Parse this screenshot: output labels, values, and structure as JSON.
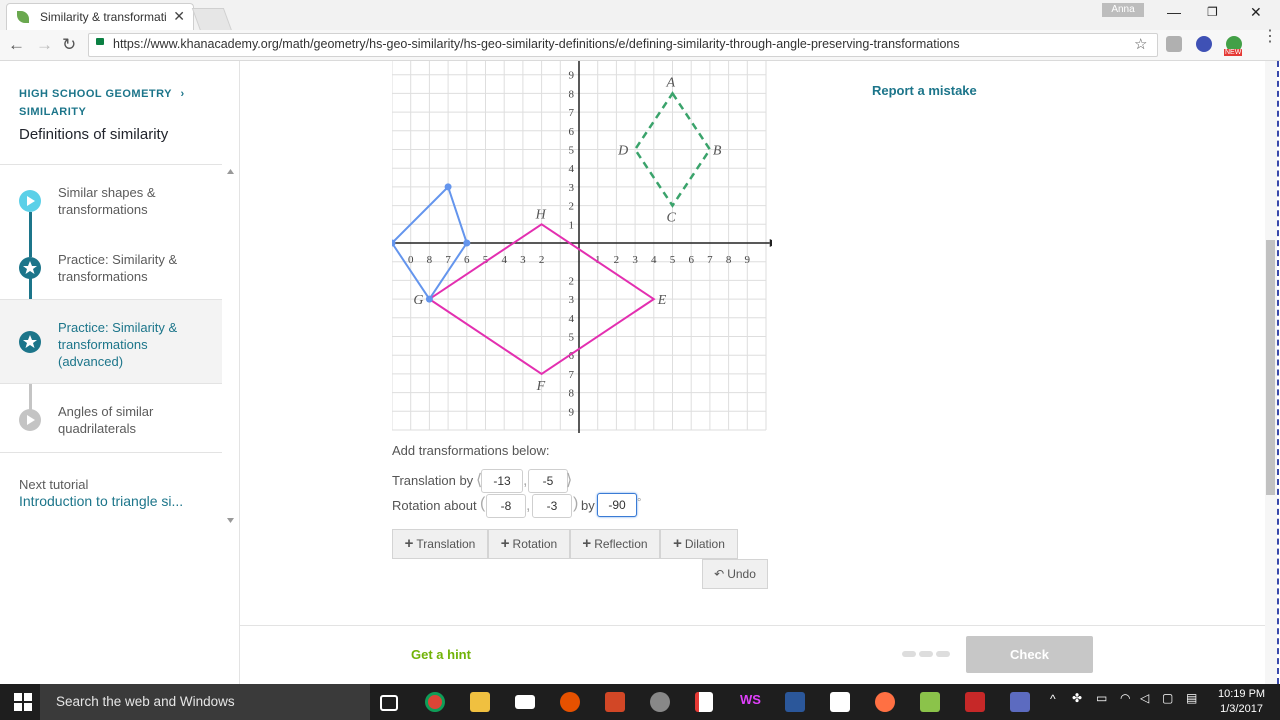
{
  "browser": {
    "tab_title": "Similarity & transformati",
    "tab_close": "✕",
    "user_name": "Anna",
    "url": "https://www.khanacademy.org/math/geometry/hs-geo-similarity/hs-geo-similarity-definitions/e/defining-similarity-through-angle-preserving-transformations",
    "new_badge": "NEW"
  },
  "sidebar": {
    "breadcrumb_course": "HIGH SCHOOL GEOMETRY",
    "breadcrumb_chevron": "›",
    "breadcrumb_unit": "SIMILARITY",
    "tutorial_title": "Definitions of similarity",
    "steps": [
      {
        "label": "Similar shapes & transformations",
        "type": "video",
        "color": "#5bd0e8"
      },
      {
        "label": "Practice: Similarity & transformations",
        "type": "exercise",
        "color": "#1c758a"
      },
      {
        "label": "Practice: Similarity & transformations (advanced)",
        "type": "exercise",
        "color": "#1c758a",
        "current": true
      },
      {
        "label": "Angles of similar quadrilaterals",
        "type": "video",
        "color": "#c4c4c4"
      }
    ],
    "next_label": "Next tutorial",
    "next_link": "Introduction to triangle si..."
  },
  "main": {
    "report_mistake": "Report a mistake",
    "add_transformations": "Add transformations below:",
    "translation": {
      "label": "Translation by",
      "x": "-13",
      "y": "-5"
    },
    "rotation": {
      "label": "Rotation about",
      "x": "-8",
      "y": "-3",
      "by_label": "by",
      "angle": "-90",
      "degree": "°"
    },
    "buttons": {
      "translation": "Translation",
      "rotation": "Rotation",
      "reflection": "Reflection",
      "dilation": "Dilation",
      "undo": "Undo"
    },
    "hint": "Get a hint",
    "check": "Check"
  },
  "graph": {
    "x_ticks": [
      "0",
      "8",
      "7",
      "6",
      "5",
      "4",
      "3",
      "2",
      "1",
      "2",
      "3",
      "4",
      "5",
      "6",
      "7",
      "8",
      "9"
    ],
    "y_ticks_pos": [
      "9",
      "8",
      "7",
      "6",
      "5",
      "4",
      "3",
      "2",
      "1"
    ],
    "y_ticks_neg": [
      "2",
      "3",
      "4",
      "5",
      "6",
      "7",
      "8",
      "9"
    ],
    "labels": {
      "A": "A",
      "B": "B",
      "C": "C",
      "D": "D",
      "E": "E",
      "F": "F",
      "G": "G",
      "H": "H"
    },
    "target_shape": {
      "A": [
        5,
        8
      ],
      "B": [
        7,
        5
      ],
      "C": [
        5,
        2
      ],
      "D": [
        3,
        5
      ],
      "color": "#3aa36b"
    },
    "magenta_shape": {
      "H": [
        -2,
        1
      ],
      "E": [
        4,
        -3
      ],
      "F": [
        -2,
        -7
      ],
      "G": [
        -8,
        -3
      ],
      "color": "#e32fb0"
    },
    "blue_shape": {
      "points": [
        [
          -7,
          3
        ],
        [
          -6,
          0
        ],
        [
          -8,
          -3
        ],
        [
          -10,
          0
        ]
      ],
      "color": "#6495ed"
    }
  },
  "taskbar": {
    "search_text": "Search the web and Windows",
    "time": "10:19 PM",
    "date": "1/3/2017"
  }
}
